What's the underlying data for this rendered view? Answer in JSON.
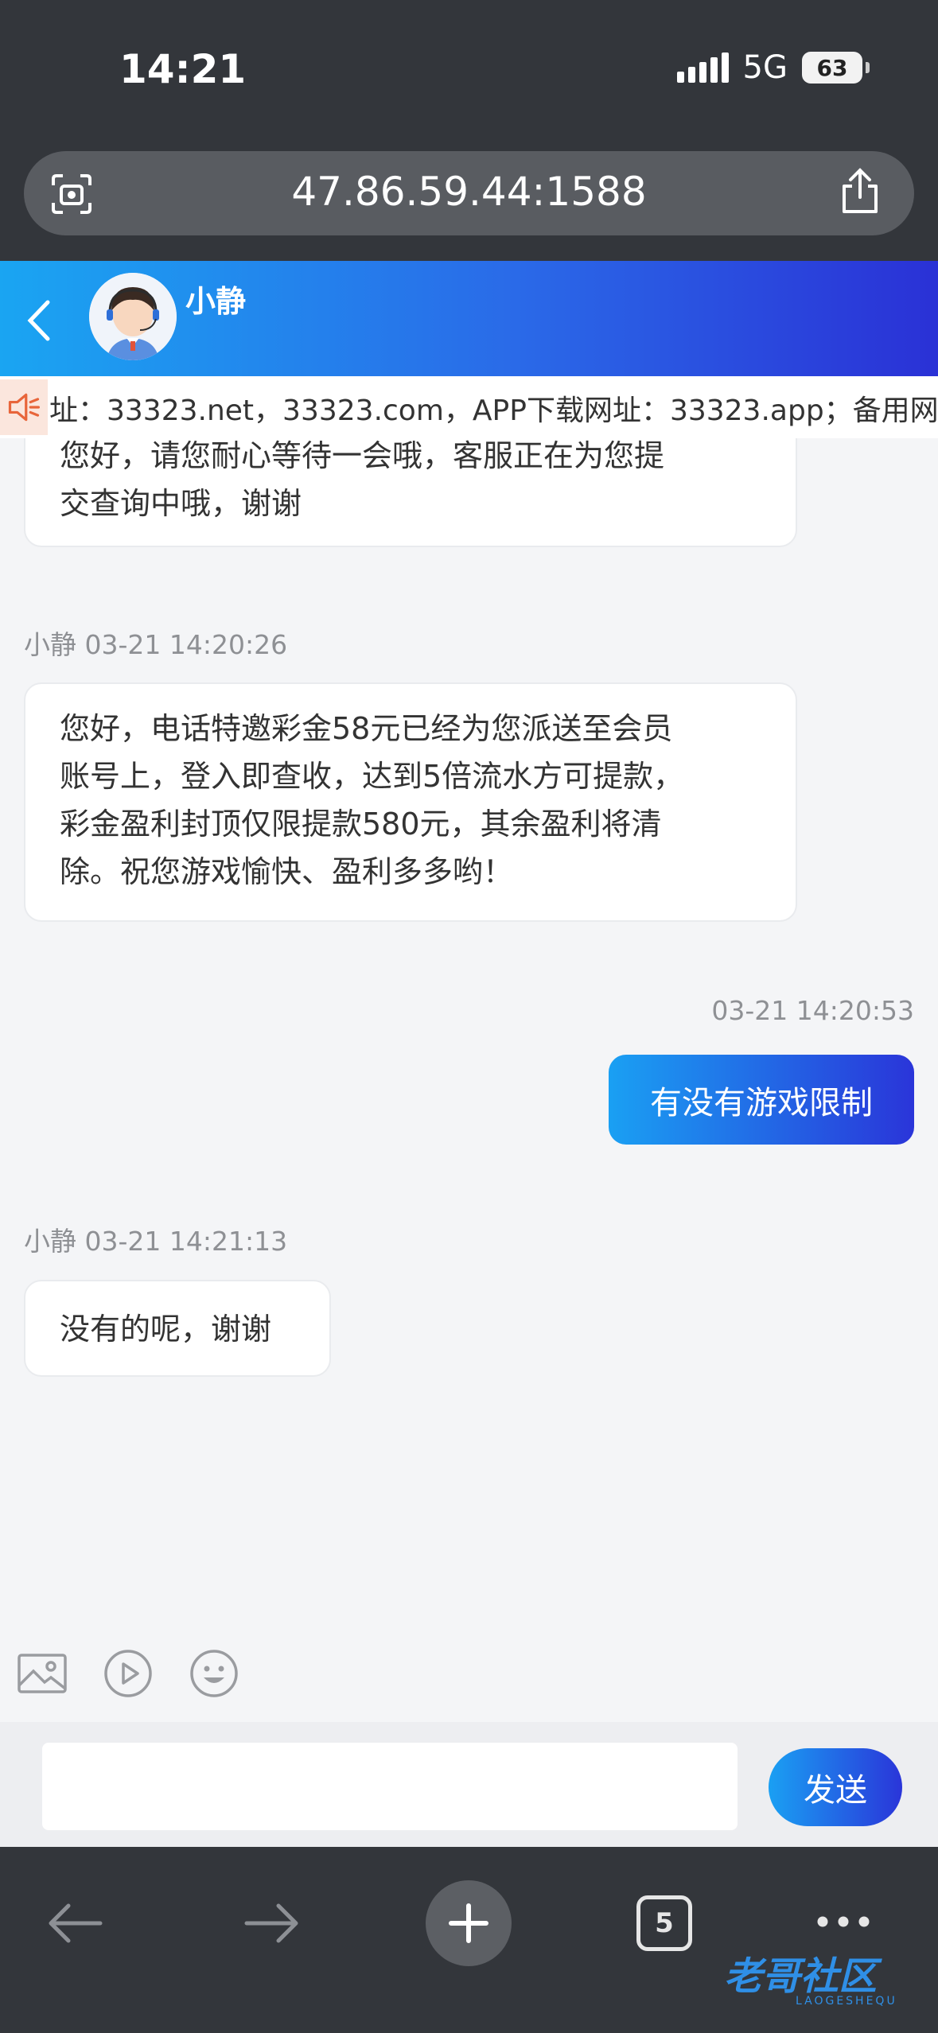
{
  "status_bar": {
    "time": "14:21",
    "network": "5G",
    "battery": "63"
  },
  "browser": {
    "url": "47.86.59.44:1588",
    "tab_count": "5"
  },
  "chat_header": {
    "agent_name": "小静"
  },
  "marquee": {
    "text": "址：33323.net，33323.com，APP下载网址：33323.app；备用网"
  },
  "messages": [
    {
      "type": "in",
      "lines": [
        "您好，请您耐心等待一会哦，客服正在为您提",
        "交查询中哦，谢谢"
      ]
    },
    {
      "type": "in",
      "meta": "小静 03-21 14:20:26",
      "lines": [
        "您好，电话特邀彩金58元已经为您派送至会员",
        "账号上，登入即查收，达到5倍流水方可提款，",
        "彩金盈利封顶仅限提款580元，其余盈利将清",
        "除。祝您游戏愉快、盈利多多哟！"
      ]
    },
    {
      "type": "out",
      "meta": "03-21 14:20:53",
      "text": "有没有游戏限制"
    },
    {
      "type": "in",
      "meta": "小静 03-21 14:21:13",
      "lines": [
        "没有的呢，谢谢"
      ]
    }
  ],
  "composer": {
    "input_value": "",
    "send_label": "发送"
  },
  "watermark": {
    "text": "老哥社区",
    "sub": "LAOGESHEQU"
  },
  "icons": {
    "scan": "scan-icon",
    "share": "share-icon",
    "back": "back-arrow-icon",
    "speaker": "speaker-icon",
    "image": "image-icon",
    "video": "video-icon",
    "emoji": "emoji-icon",
    "nav_back": "arrow-left-icon",
    "nav_forward": "arrow-right-icon",
    "new_tab": "plus-icon",
    "more": "more-icon"
  },
  "colors": {
    "header_start": "#1aa5f2",
    "header_end": "#2a31d6",
    "dark_chrome": "#33363b"
  }
}
